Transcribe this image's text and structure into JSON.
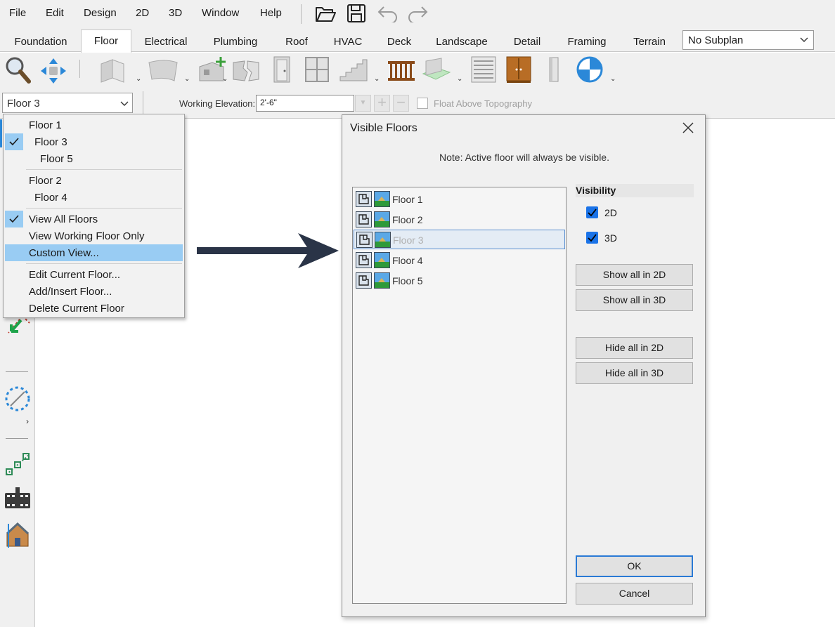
{
  "menubar": {
    "items": [
      "File",
      "Edit",
      "Design",
      "2D",
      "3D",
      "Window",
      "Help"
    ]
  },
  "tabs": [
    "Foundation",
    "Floor",
    "Electrical",
    "Plumbing",
    "Roof",
    "HVAC",
    "Deck",
    "Landscape",
    "Detail",
    "Framing",
    "Terrain"
  ],
  "active_tab": "Floor",
  "subplan": {
    "value": "No Subplan"
  },
  "toolbar2": {
    "floor_select": "Floor 3",
    "working_elevation_label": "Working Elevation:",
    "working_elevation_value": "2'-6\"",
    "float_above_label": "Float Above Topography"
  },
  "floor_menu": {
    "group1": [
      "Floor 1",
      "Floor 3",
      "Floor 5"
    ],
    "group2": [
      "Floor 2",
      "Floor 4"
    ],
    "view_items": [
      "View All Floors",
      "View Working Floor Only",
      "Custom View..."
    ],
    "actions": [
      "Edit Current Floor...",
      "Add/Insert Floor...",
      "Delete Current Floor"
    ]
  },
  "dialog": {
    "title": "Visible Floors",
    "note": "Note: Active floor will always be visible.",
    "floors": [
      "Floor 1",
      "Floor 2",
      "Floor 3",
      "Floor 4",
      "Floor 5"
    ],
    "visibility_heading": "Visibility",
    "cb_2d": "2D",
    "cb_3d": "3D",
    "show_2d": "Show all in 2D",
    "show_3d": "Show all in 3D",
    "hide_2d": "Hide all in 2D",
    "hide_3d": "Hide all in 3D",
    "ok": "OK",
    "cancel": "Cancel"
  },
  "colors": {
    "highlight": "#99ccf3",
    "checkbox": "#1a73e8",
    "arrow": "#2a3447",
    "default_button_border": "#2a7ad5"
  }
}
